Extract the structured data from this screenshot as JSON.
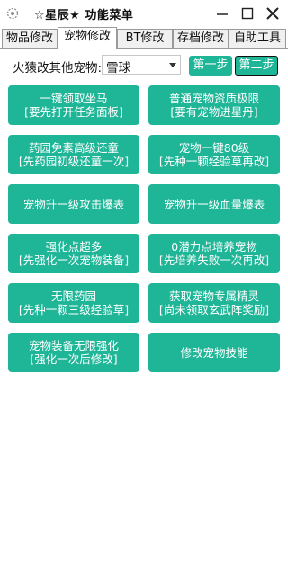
{
  "window": {
    "title": "☆星辰★ 功能菜单",
    "minimize_icon": "minimize-icon",
    "maximize_icon": "maximize-icon",
    "close_icon": "close-icon"
  },
  "tabs": [
    {
      "label": "物品修改",
      "active": false
    },
    {
      "label": "宠物修改",
      "active": true
    },
    {
      "label": "BT修改",
      "active": false
    },
    {
      "label": "存档修改",
      "active": false
    },
    {
      "label": "自助工具",
      "active": false
    }
  ],
  "selector": {
    "label": "火猿改其他宠物:",
    "value": "雪球",
    "step1": "第一步",
    "step2": "第二步"
  },
  "buttons": [
    {
      "line1": "一键领取坐马",
      "line2": "[要先打开任务面板]"
    },
    {
      "line1": "普通宠物资质极限",
      "line2": "[要有宠物进星丹]"
    },
    {
      "line1": "药园免素高级还童",
      "line2": "[先药园初级还童一次]"
    },
    {
      "line1": "宠物一键80级",
      "line2": "[先种一颗经验草再改]"
    },
    {
      "line1": "宠物升一级攻击爆表",
      "line2": ""
    },
    {
      "line1": "宠物升一级血量爆表",
      "line2": ""
    },
    {
      "line1": "强化点超多",
      "line2": "[先强化一次宠物装备]"
    },
    {
      "line1": "0潜力点培养宠物",
      "line2": "[先培养失败一次再改]"
    },
    {
      "line1": "无限药园",
      "line2": "[先种一颗三级经验草]"
    },
    {
      "line1": "获取宠物专属精灵",
      "line2": "[尚未领取玄武阵奖励]"
    },
    {
      "line1": "宠物装备无限强化",
      "line2": "[强化一次后修改]"
    },
    {
      "line1": "修改宠物技能",
      "line2": ""
    }
  ],
  "colors": {
    "accent": "#1fb597",
    "button_text": "#ffffff"
  }
}
